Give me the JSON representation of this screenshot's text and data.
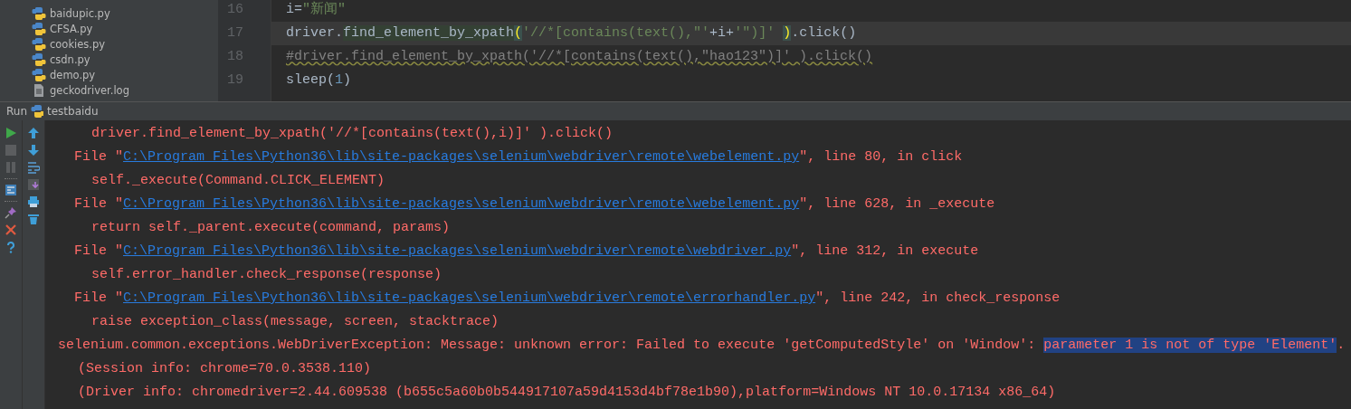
{
  "project_tree": {
    "items": [
      {
        "name": "baidupic.py",
        "kind": "python"
      },
      {
        "name": "CFSA.py",
        "kind": "python"
      },
      {
        "name": "cookies.py",
        "kind": "python"
      },
      {
        "name": "csdn.py",
        "kind": "python"
      },
      {
        "name": "demo.py",
        "kind": "python"
      },
      {
        "name": "geckodriver.log",
        "kind": "log"
      }
    ]
  },
  "editor": {
    "lines": [
      {
        "number": "16",
        "current": false,
        "tokens": [
          {
            "text": "i=",
            "kind": "plain"
          },
          {
            "text": "\"新闻\"",
            "kind": "string"
          }
        ]
      },
      {
        "number": "17",
        "current": true,
        "tokens": [
          {
            "text": "driver.",
            "kind": "plain"
          },
          {
            "text": "find_element_by_xpath",
            "kind": "usage"
          },
          {
            "text": "(",
            "kind": "brace"
          },
          {
            "text": "'//*[contains(text(),\"'",
            "kind": "string"
          },
          {
            "text": "+i+",
            "kind": "plain"
          },
          {
            "text": "'\")]' ",
            "kind": "string"
          },
          {
            "text": ")",
            "kind": "brace"
          },
          {
            "text": ".click()",
            "kind": "plain"
          }
        ]
      },
      {
        "number": "18",
        "current": false,
        "tokens": [
          {
            "text": "#driver.find_element_by_xpath('//*[contains(text(),\"hao123\")]' ).click()",
            "kind": "comment"
          }
        ]
      },
      {
        "number": "19",
        "current": false,
        "tokens": [
          {
            "text": "sleep(",
            "kind": "plain"
          },
          {
            "text": "1",
            "kind": "number"
          },
          {
            "text": ")",
            "kind": "plain"
          }
        ]
      }
    ]
  },
  "run_panel": {
    "label": "Run",
    "config": "testbaidu"
  },
  "console": {
    "lines": [
      {
        "kind": "code",
        "text": "driver.find_element_by_xpath('//*[contains(text(),i)]' ).click()"
      },
      {
        "kind": "frame",
        "prefix": "File \"",
        "link": "C:\\Program Files\\Python36\\lib\\site-packages\\selenium\\webdriver\\remote\\webelement.py",
        "suffix": "\", line 80, in click"
      },
      {
        "kind": "code",
        "text": "self._execute(Command.CLICK_ELEMENT)"
      },
      {
        "kind": "frame",
        "prefix": "File \"",
        "link": "C:\\Program Files\\Python36\\lib\\site-packages\\selenium\\webdriver\\remote\\webelement.py",
        "suffix": "\", line 628, in _execute"
      },
      {
        "kind": "code",
        "text": "return self._parent.execute(command, params)"
      },
      {
        "kind": "frame",
        "prefix": "File \"",
        "link": "C:\\Program Files\\Python36\\lib\\site-packages\\selenium\\webdriver\\remote\\webdriver.py",
        "suffix": "\", line 312, in execute"
      },
      {
        "kind": "code",
        "text": "self.error_handler.check_response(response)"
      },
      {
        "kind": "frame",
        "prefix": "File \"",
        "link": "C:\\Program Files\\Python36\\lib\\site-packages\\selenium\\webdriver\\remote\\errorhandler.py",
        "suffix": "\", line 242, in check_response"
      },
      {
        "kind": "code",
        "text": "raise exception_class(message, screen, stacktrace)"
      },
      {
        "kind": "exception",
        "parts": [
          {
            "text": "selenium.common.exceptions.WebDriverException: Message: unknown error: Failed to execute 'getComputedStyle' on 'Window': ",
            "selected": false
          },
          {
            "text": "parameter 1 is not of type 'Element'",
            "selected": true
          },
          {
            "text": ".",
            "selected": false
          }
        ]
      },
      {
        "kind": "info",
        "text": "(Session info: chrome=70.0.3538.110)"
      },
      {
        "kind": "info",
        "text": "(Driver info: chromedriver=2.44.609538 (b655c5a60b0b544917107a59d4153d4bf78e1b90),platform=Windows NT 10.0.17134 x86_64)"
      }
    ]
  }
}
